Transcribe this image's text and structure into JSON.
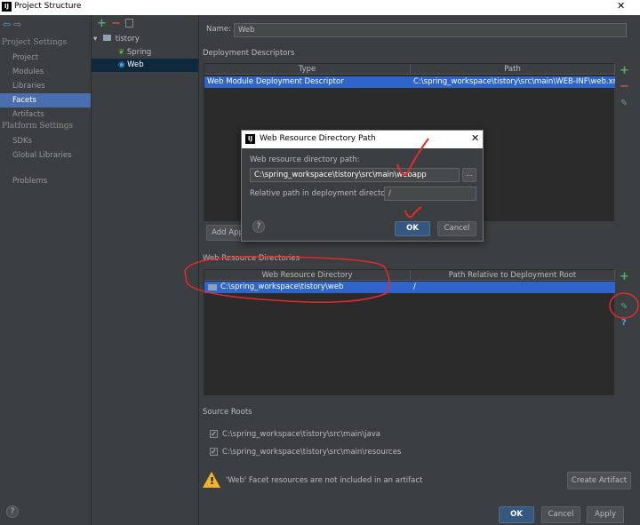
{
  "window": {
    "title": "Project Structure",
    "logo": "IJ",
    "close": "✕"
  },
  "nav": {
    "project_settings_header": "Project Settings",
    "project_settings": [
      "Project",
      "Modules",
      "Libraries",
      "Facets",
      "Artifacts"
    ],
    "platform_settings_header": "Platform Settings",
    "platform_settings": [
      "SDKs",
      "Global Libraries"
    ],
    "problems": "Problems"
  },
  "facet_tree": {
    "root": "tistory",
    "children": [
      "Spring",
      "Web"
    ]
  },
  "form": {
    "name_label": "Name:",
    "name_value": "Web",
    "deployment_descriptors_header": "Deployment Descriptors",
    "dd_columns": [
      "Type",
      "Path"
    ],
    "dd_rows": [
      {
        "type": "Web Module Deployment Descriptor",
        "path": "C:\\spring_workspace\\tistory\\src\\main\\WEB-INF\\web.xml"
      }
    ],
    "add_app_button": "Add App",
    "web_resource_header": "Web Resource Directories",
    "wr_columns": [
      "Web Resource Directory",
      "Path Relative to Deployment Root"
    ],
    "wr_rows": [
      {
        "dir": "C:\\spring_workspace\\tistory\\web",
        "rel": "/"
      }
    ],
    "source_roots_header": "Source Roots",
    "source_roots": [
      "C:\\spring_workspace\\tistory\\src\\main\\java",
      "C:\\spring_workspace\\tistory\\src\\main\\resources"
    ],
    "warning_text": "'Web' Facet resources are not included in an artifact",
    "create_artifact_button": "Create Artifact"
  },
  "dialog": {
    "title": "Web Resource Directory Path",
    "dir_label": "Web resource directory path:",
    "dir_value": "C:\\spring_workspace\\tistory\\src\\main\\webapp",
    "browse": "...",
    "rel_label": "Relative path in deployment directory:",
    "rel_value": "/",
    "help": "?",
    "ok": "OK",
    "cancel": "Cancel"
  },
  "footer": {
    "help": "?",
    "ok": "OK",
    "cancel": "Cancel",
    "apply": "Apply"
  },
  "colors": {
    "selection": "#4b6eaf",
    "table_selection": "#2f65ca",
    "annotation": "#e52a2a",
    "add": "#59a869",
    "remove": "#c75450"
  },
  "icons": [
    "back-arrow-icon",
    "forward-arrow-icon",
    "add-icon",
    "remove-icon",
    "copy-icon",
    "folder-icon",
    "spring-leaf-icon",
    "web-icon",
    "edit-icon",
    "help-icon",
    "warning-icon"
  ]
}
